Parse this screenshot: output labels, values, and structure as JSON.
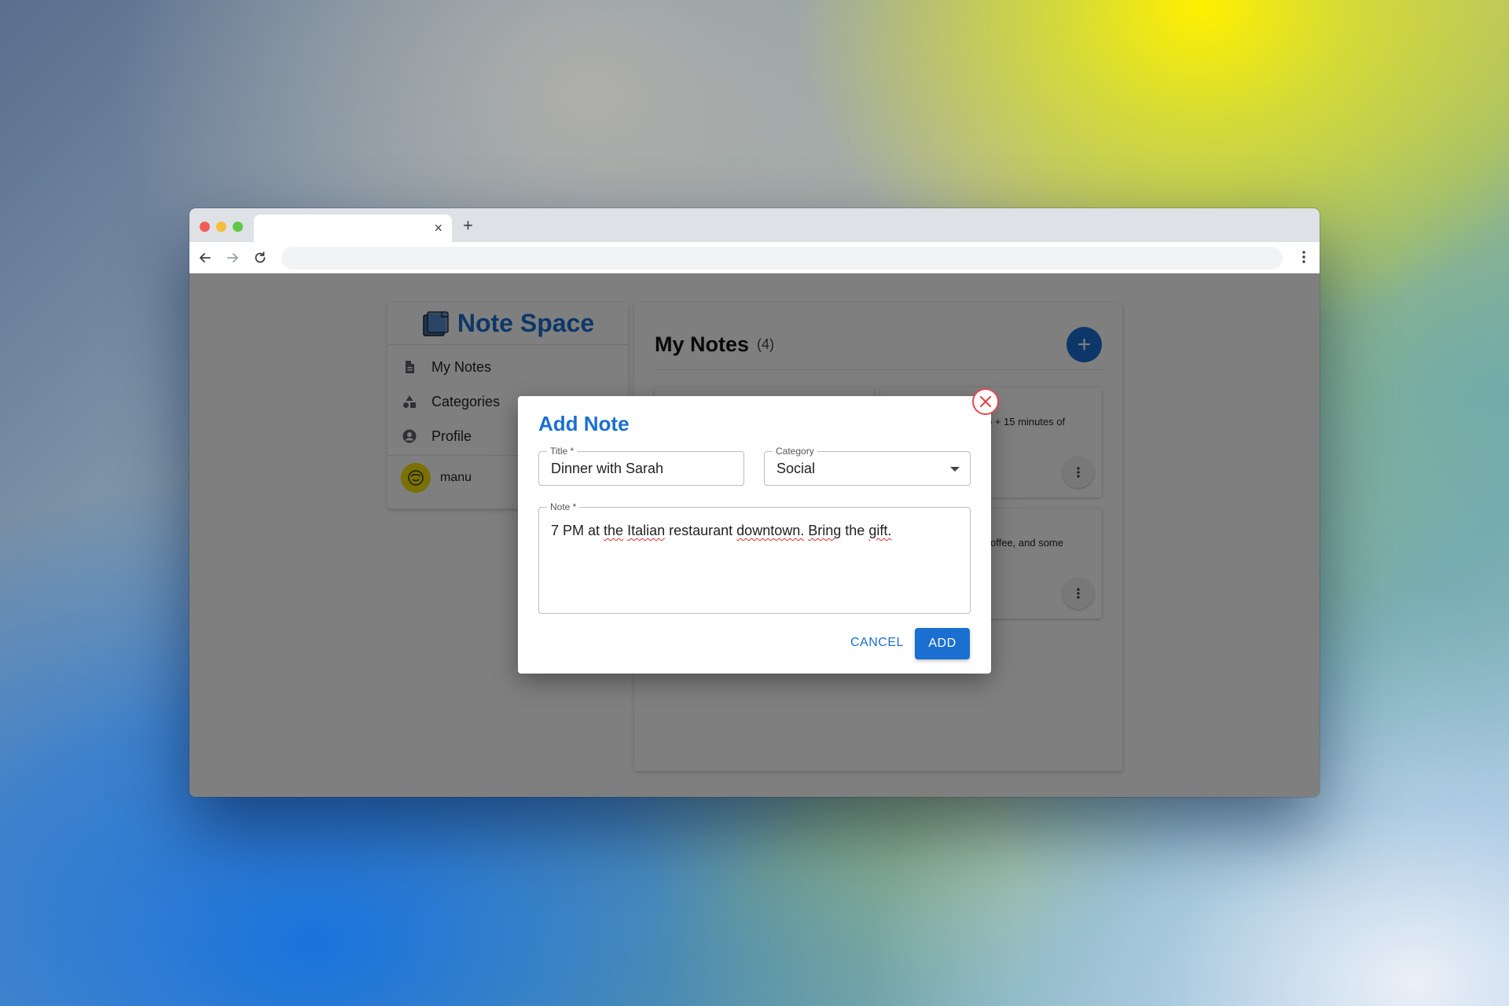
{
  "browser": {
    "tab_title": "",
    "address": "",
    "tab_close": "×",
    "new_tab": "+"
  },
  "app": {
    "brand": "Note Space",
    "accent_color": "#1a6fd0"
  },
  "sidebar": {
    "items": [
      {
        "label": "My Notes",
        "icon": "document-icon"
      },
      {
        "label": "Categories",
        "icon": "shapes-icon"
      },
      {
        "label": "Profile",
        "icon": "account-circle-icon"
      }
    ],
    "user": {
      "name": "manu"
    }
  },
  "main": {
    "title": "My Notes",
    "count": "(4)",
    "add_fab": "+",
    "notes": [
      {
        "snippet": "o + 15 minutes of"
      },
      {
        "snippet": "offee, and some"
      }
    ]
  },
  "dialog": {
    "title": "Add Note",
    "fields": {
      "title": {
        "label": "Title *",
        "value": "Dinner with Sarah"
      },
      "category": {
        "label": "Category",
        "value": "Social"
      },
      "note": {
        "label": "Note *",
        "value_parts": [
          "7 PM at ",
          "the",
          " ",
          "Italian",
          " restaurant ",
          "downtown.",
          " ",
          "Bring",
          " the ",
          "gift."
        ]
      }
    },
    "cancel_label": "CANCEL",
    "add_label": "ADD"
  }
}
